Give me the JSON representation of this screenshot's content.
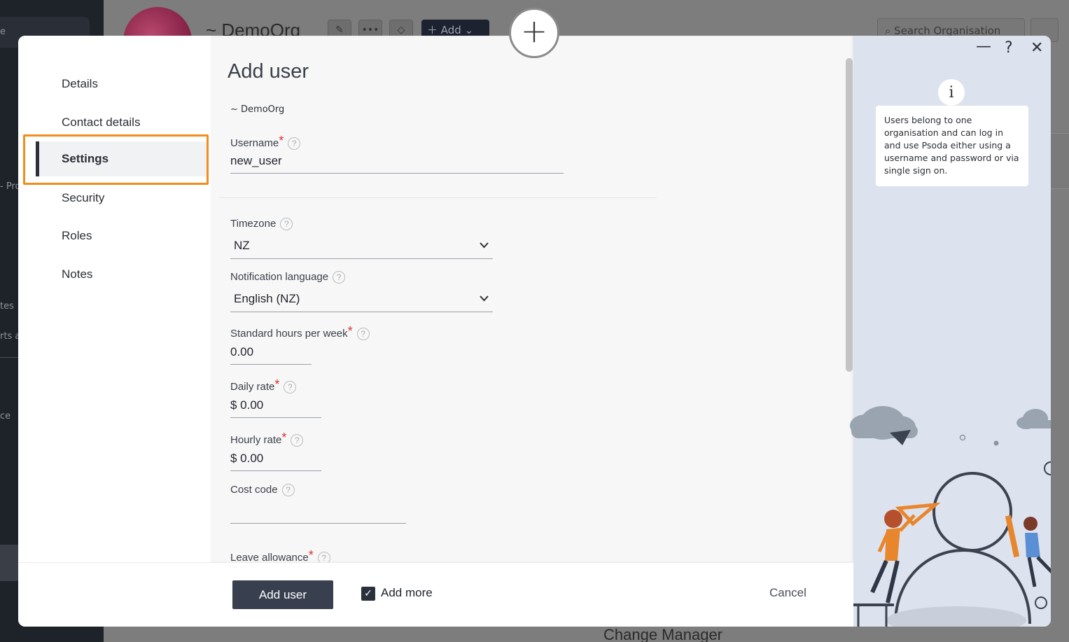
{
  "background": {
    "org_title": "~ DemoOrg",
    "add_button": "Add",
    "search_placeholder": "Search Organisation",
    "sidebar_fragments": [
      "e",
      "- Pro",
      "tes",
      "rts a",
      "ce"
    ],
    "bottom_text": "Change Manager"
  },
  "modal": {
    "title": "Add user",
    "org": "~ DemoOrg",
    "nav": {
      "items": [
        {
          "label": "Details"
        },
        {
          "label": "Contact details"
        },
        {
          "label": "Settings",
          "active": true
        },
        {
          "label": "Security"
        },
        {
          "label": "Roles"
        },
        {
          "label": "Notes"
        }
      ]
    },
    "fields": {
      "username": {
        "label": "Username",
        "value": "new_user"
      },
      "timezone": {
        "label": "Timezone",
        "value": "NZ"
      },
      "notification_language": {
        "label": "Notification language",
        "value": "English (NZ)"
      },
      "standard_hours": {
        "label": "Standard hours per week",
        "value": "0.00"
      },
      "daily_rate": {
        "label": "Daily rate",
        "value": "$ 0.00"
      },
      "hourly_rate": {
        "label": "Hourly rate",
        "value": "$ 0.00"
      },
      "cost_code": {
        "label": "Cost code",
        "value": ""
      },
      "leave_allowance": {
        "label": "Leave allowance"
      }
    },
    "help_glyph": "?",
    "required_mark": "*",
    "footer": {
      "add_button": "Add user",
      "add_more_label": "Add more",
      "add_more_checked": true,
      "checkmark": "✓",
      "cancel": "Cancel"
    },
    "info": {
      "icon": "i",
      "text": "Users belong to one organisation and can log in and use Psoda either using a username and password or via single sign on."
    },
    "window_controls": {
      "minimize": "—",
      "help": "?",
      "close": "✕"
    }
  },
  "colors": {
    "accent_highlight": "#f28c1c",
    "primary_button": "#38404f",
    "required": "#e03030",
    "info_panel": "#dde3ee"
  }
}
